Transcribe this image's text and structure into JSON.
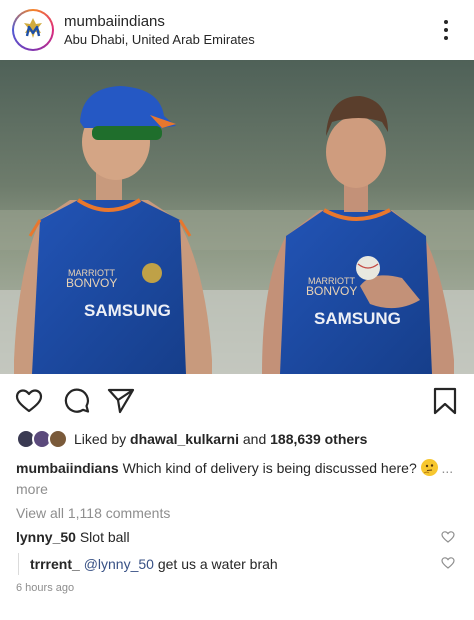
{
  "post": {
    "username": "mumbaiindians",
    "location": "Abu Dhabi, United Arab Emirates",
    "likes": {
      "prefix": "Liked by ",
      "liker": "dhawal_kulkarni",
      "connector": " and ",
      "others": "188,639 others"
    },
    "caption": {
      "user": "mumbaiindians",
      "text": "Which kind of delivery is being discussed here?",
      "more": "... more"
    },
    "view_all_comments": "View all 1,118 comments",
    "comments": [
      {
        "user": "lynny_50",
        "text": "Slot ball"
      },
      {
        "user": "trrrent_",
        "mention": "@lynny_50",
        "text": "get us a water brah"
      }
    ],
    "timestamp": "6 hours ago"
  },
  "photo_text": {
    "sponsor": "SAMSUNG",
    "partner_line1": "MARRIOTT",
    "partner_line2": "BONVOY"
  },
  "colors": {
    "text": "#262626",
    "muted": "#8e8e8e",
    "jersey": "#1d4fa8",
    "jersey_trim": "#e8772e"
  },
  "icons": {
    "like": "heart-icon",
    "comment": "comment-icon",
    "share": "send-icon",
    "save": "bookmark-icon",
    "more": "more-options-icon"
  }
}
